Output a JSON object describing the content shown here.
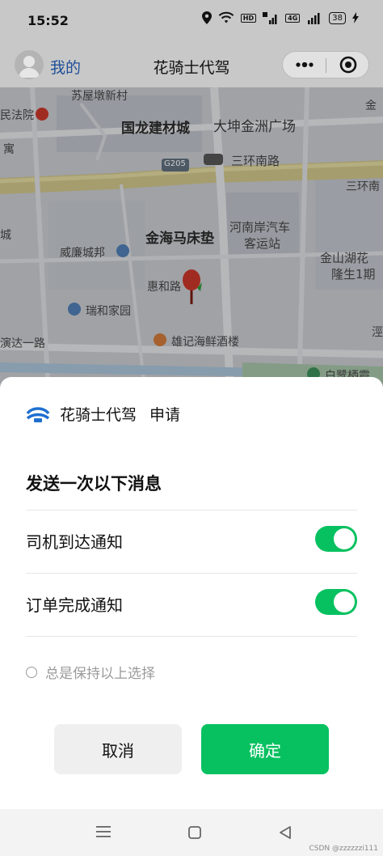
{
  "status_bar": {
    "time": "15:52",
    "hd_badge": "HD",
    "network": "4G",
    "battery": "38"
  },
  "nav": {
    "back_label": "我的",
    "title": "花骑士代驾"
  },
  "map": {
    "labels": [
      "苏屋墩新村",
      "民法院",
      "国龙建材城",
      "大坤金洲广场",
      "寓",
      "三环南路",
      "三环南",
      "G205",
      "金海马床垫",
      "河南岸汽车",
      "客运站",
      "威廉城邦",
      "金山湖花",
      "隆生1期",
      "惠和路",
      "瑞和家园",
      "演达一路",
      "雄记海鲜酒楼",
      "白鹭栖霞",
      "城",
      "金",
      "涇"
    ]
  },
  "sheet": {
    "app_name": "花骑士代驾",
    "action": "申请",
    "title": "发送一次以下消息",
    "options": [
      {
        "label": "司机到达通知",
        "enabled": true
      },
      {
        "label": "订单完成通知",
        "enabled": true
      }
    ],
    "keep_label": "总是保持以上选择",
    "cancel_label": "取消",
    "confirm_label": "确定"
  },
  "watermark": "CSDN @zzzzzzi111",
  "colors": {
    "accent_green": "#07c160",
    "nav_link": "#1f4f99"
  }
}
